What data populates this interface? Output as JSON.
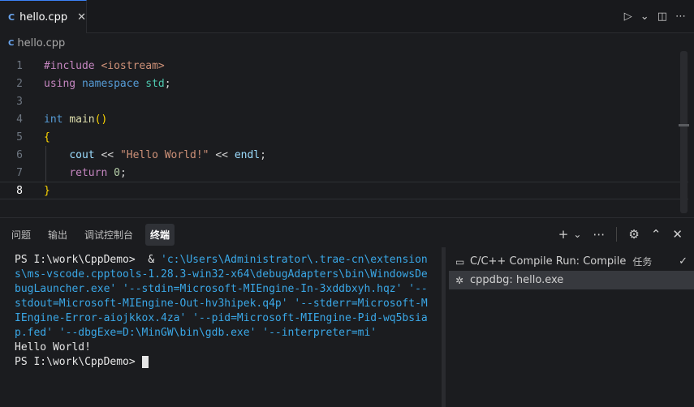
{
  "editor_tab": {
    "icon": "C",
    "label": "hello.cpp",
    "close": "✕"
  },
  "top_actions": {
    "run": "▷",
    "run_menu": "⌄",
    "split": "◫",
    "more": "⋯"
  },
  "breadcrumb": {
    "icon": "C",
    "file": "hello.cpp"
  },
  "code": {
    "line_numbers": [
      "1",
      "2",
      "3",
      "4",
      "5",
      "6",
      "7",
      "8"
    ],
    "l1": {
      "pre": "#include",
      "inc": "<iostream>"
    },
    "l2": {
      "using": "using",
      "namespace": "namespace",
      "std": "std",
      "semi": ";"
    },
    "l4": {
      "int": "int",
      "main": "main",
      "parens": "()"
    },
    "l5": {
      "brace": "{"
    },
    "l6": {
      "cout": "cout",
      "op1": " << ",
      "str": "\"Hello World!\"",
      "op2": " << ",
      "endl": "endl",
      "semi": ";"
    },
    "l7": {
      "ret": "return",
      "zero": "0",
      "semi": ";"
    },
    "l8": {
      "brace": "}"
    }
  },
  "panel": {
    "tabs": [
      "问题",
      "输出",
      "调试控制台",
      "终端"
    ],
    "actions": {
      "add": "+",
      "add_menu": "⌄",
      "more": "⋯",
      "customize": "⚙",
      "maximize": "⌃",
      "close": "✕"
    }
  },
  "terminal": {
    "line1_prompt": "PS I:\\work\\CppDemo>",
    "line1_cmd": "  & ",
    "line1_path": "'c:\\Users\\Administrator\\.trae-cn\\extension",
    "wrapped": [
      "s\\ms-vscode.cpptools-1.28.3-win32-x64\\debugAdapters\\bin\\WindowsDe",
      "bugLauncher.exe' '--stdin=Microsoft-MIEngine-In-3xddbxyh.hqz' '--",
      "stdout=Microsoft-MIEngine-Out-hv3hipek.q4p' '--stderr=Microsoft-M",
      "IEngine-Error-aiojkkox.4za' '--pid=Microsoft-MIEngine-Pid-wq5bsia",
      "p.fed' '--dbgExe=D:\\MinGW\\bin\\gdb.exe' '--interpreter=mi'"
    ],
    "output": "Hello World!",
    "prompt": "PS I:\\work\\CppDemo>"
  },
  "terminal_list": [
    {
      "icon": "▭",
      "label": "C/C++ Compile Run: Compile",
      "tag": "任务",
      "check": "✓"
    },
    {
      "icon": "✲",
      "label": "cppdbg: hello.exe"
    }
  ]
}
